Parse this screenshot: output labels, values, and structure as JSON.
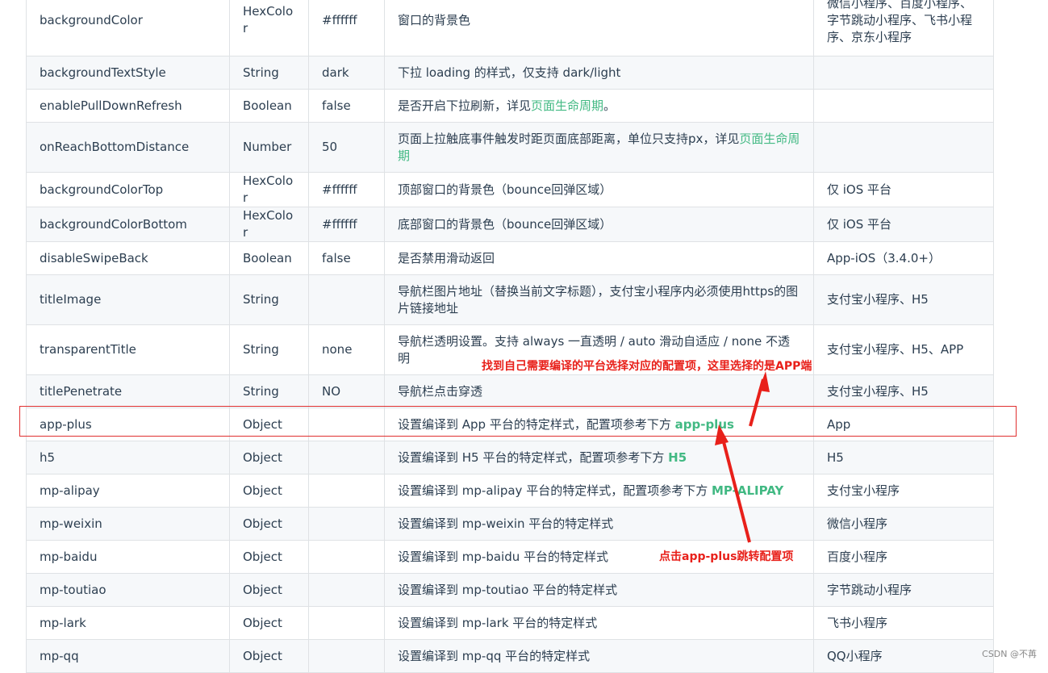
{
  "rows": [
    {
      "attr": "backgroundColor",
      "type": "HexColor",
      "default": "#ffffff",
      "desc": "窗口的背景色",
      "platform": "微信小程序、百度小程序、字节跳动小程序、飞书小程序、京东小程序"
    },
    {
      "attr": "backgroundTextStyle",
      "type": "String",
      "default": "dark",
      "desc": "下拉 loading 的样式，仅支持 dark/light",
      "platform": ""
    },
    {
      "attr": "enablePullDownRefresh",
      "type": "Boolean",
      "default": "false",
      "desc_prefix": "是否开启下拉刷新，详见",
      "desc_link": "页面生命周期",
      "desc_suffix": "。",
      "platform": ""
    },
    {
      "attr": "onReachBottomDistance",
      "type": "Number",
      "default": "50",
      "desc_prefix": "页面上拉触底事件触发时距页面底部距离，单位只支持px，详见",
      "desc_link": "页面生命周期",
      "platform": ""
    },
    {
      "attr": "backgroundColorTop",
      "type": "HexColor",
      "default": "#ffffff",
      "desc": "顶部窗口的背景色（bounce回弹区域）",
      "platform": "仅 iOS 平台"
    },
    {
      "attr": "backgroundColorBottom",
      "type": "HexColor",
      "default": "#ffffff",
      "desc": "底部窗口的背景色（bounce回弹区域）",
      "platform": "仅 iOS 平台"
    },
    {
      "attr": "disableSwipeBack",
      "type": "Boolean",
      "default": "false",
      "desc": "是否禁用滑动返回",
      "platform": "App-iOS（3.4.0+）"
    },
    {
      "attr": "titleImage",
      "type": "String",
      "default": "",
      "desc": "导航栏图片地址（替换当前文字标题），支付宝小程序内必须使用https的图片链接地址",
      "platform": "支付宝小程序、H5"
    },
    {
      "attr": "transparentTitle",
      "type": "String",
      "default": "none",
      "desc": "导航栏透明设置。支持 always 一直透明 / auto 滑动自适应 / none 不透明",
      "platform": "支付宝小程序、H5、APP"
    },
    {
      "attr": "titlePenetrate",
      "type": "String",
      "default": "NO",
      "desc": "导航栏点击穿透",
      "platform": "支付宝小程序、H5"
    },
    {
      "attr": "app-plus",
      "type": "Object",
      "default": "",
      "desc_prefix": "设置编译到 App 平台的特定样式，配置项参考下方 ",
      "desc_link": "app-plus",
      "platform": "App"
    },
    {
      "attr": "h5",
      "type": "Object",
      "default": "",
      "desc_prefix": "设置编译到 H5 平台的特定样式，配置项参考下方 ",
      "desc_link": "H5",
      "platform": "H5"
    },
    {
      "attr": "mp-alipay",
      "type": "Object",
      "default": "",
      "desc_prefix": "设置编译到 mp-alipay 平台的特定样式，配置项参考下方 ",
      "desc_link": "MP-ALIPAY",
      "platform": "支付宝小程序"
    },
    {
      "attr": "mp-weixin",
      "type": "Object",
      "default": "",
      "desc": "设置编译到 mp-weixin 平台的特定样式",
      "platform": "微信小程序"
    },
    {
      "attr": "mp-baidu",
      "type": "Object",
      "default": "",
      "desc": "设置编译到 mp-baidu 平台的特定样式",
      "platform": "百度小程序"
    },
    {
      "attr": "mp-toutiao",
      "type": "Object",
      "default": "",
      "desc": "设置编译到 mp-toutiao 平台的特定样式",
      "platform": "字节跳动小程序"
    },
    {
      "attr": "mp-lark",
      "type": "Object",
      "default": "",
      "desc": "设置编译到 mp-lark 平台的特定样式",
      "platform": "飞书小程序"
    },
    {
      "attr": "mp-qq",
      "type": "Object",
      "default": "",
      "desc": "设置编译到 mp-qq 平台的特定样式",
      "platform": "QQ小程序"
    }
  ],
  "annotations": {
    "top": "找到自己需要编译的平台选择对应的配置项，这里选择的是APP端",
    "bottom": "点击app-plus跳转配置项"
  },
  "watermark": "CSDN @不苒",
  "colors": {
    "link": "#42b983",
    "annotation": "#e8201a",
    "border": "#dfe2e5",
    "stripe": "#f6f8fa"
  }
}
